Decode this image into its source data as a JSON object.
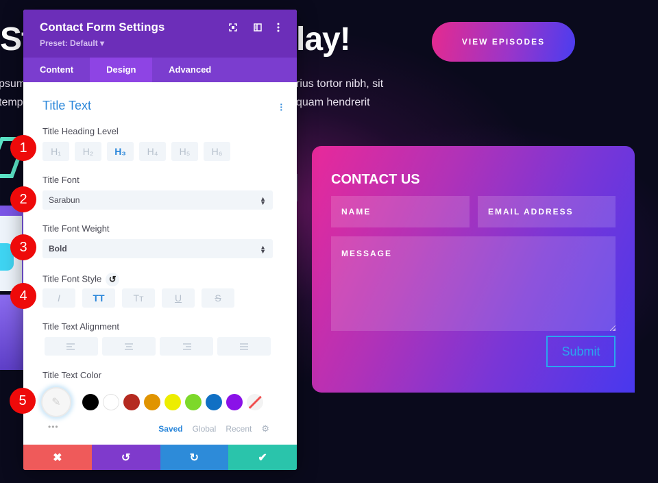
{
  "page": {
    "hero_title_left": "St",
    "hero_title_right": "lay!",
    "hero_lines_left": [
      "psum",
      "temp"
    ],
    "hero_lines_right": [
      "rius tortor nibh, sit",
      "quam hendrerit"
    ],
    "cta_label": "VIEW EPISODES"
  },
  "contact_form": {
    "title": "CONTACT US",
    "name_placeholder": "NAME",
    "email_placeholder": "EMAIL ADDRESS",
    "message_placeholder": "MESSAGE",
    "submit_label": "Submit",
    "colors": {
      "gradient_start": "#e8299a",
      "gradient_end": "#4838ee",
      "submit": "#2aa6ee"
    }
  },
  "panel": {
    "title": "Contact Form Settings",
    "preset": "Preset: Default ▾",
    "header_icons": [
      "expand-icon",
      "sidebar-toggle-icon",
      "more-vertical-icon"
    ],
    "tabs": [
      {
        "label": "Content",
        "active": false
      },
      {
        "label": "Design",
        "active": true
      },
      {
        "label": "Advanced",
        "active": false
      }
    ],
    "section_title": "Title Text",
    "heading_level": {
      "label": "Title Heading Level",
      "options": [
        "H₁",
        "H₂",
        "H₃",
        "H₄",
        "H₅",
        "H₆"
      ],
      "selected": "H₃"
    },
    "font": {
      "label": "Title Font",
      "value": "Sarabun"
    },
    "font_weight": {
      "label": "Title Font Weight",
      "value": "Bold"
    },
    "font_style": {
      "label": "Title Font Style",
      "options": [
        "I",
        "TT",
        "Tт",
        "U",
        "S"
      ],
      "selected": "TT"
    },
    "alignment": {
      "label": "Title Text Alignment",
      "options": [
        "≡",
        "≡",
        "≡",
        "≡"
      ]
    },
    "text_color": {
      "label": "Title Text Color",
      "swatches": [
        "#000000",
        "#ffffff",
        "#b52a20",
        "#e09400",
        "#eded00",
        "#7dd82a",
        "#1070c4",
        "#8a12e8"
      ],
      "palette_tabs": [
        "Saved",
        "Global",
        "Recent"
      ],
      "active_palette": "Saved",
      "more": "•••"
    },
    "footer": {
      "cancel": "✖",
      "undo": "↺",
      "redo": "↻",
      "save": "✔"
    }
  },
  "badges": [
    "1",
    "2",
    "3",
    "4",
    "5"
  ]
}
